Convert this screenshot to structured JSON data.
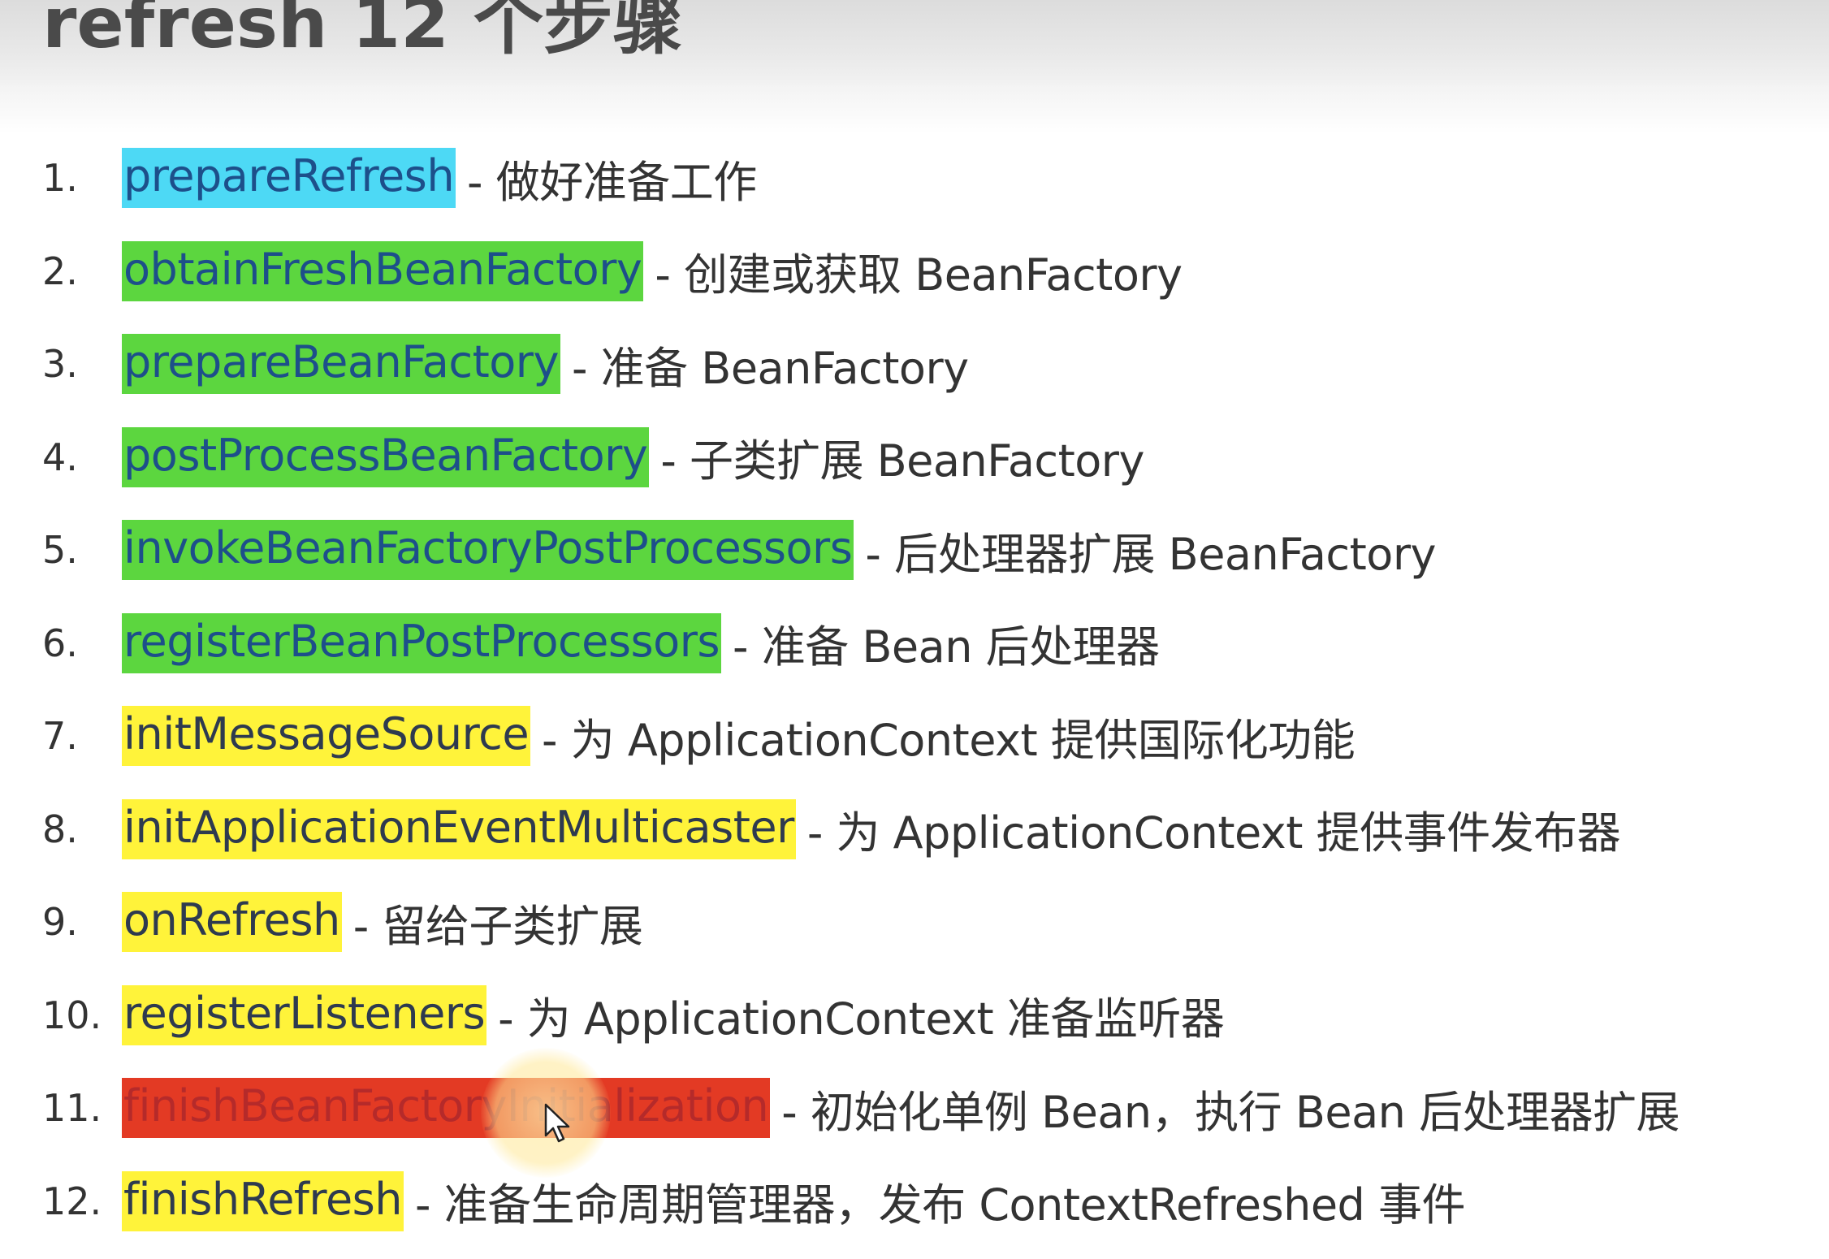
{
  "page": {
    "title": "refresh 12 个步骤"
  },
  "steps": [
    {
      "number": "1.",
      "method": "prepareRefresh",
      "highlight": "#4dd9f5",
      "description": "- 做好准备工作"
    },
    {
      "number": "2.",
      "method": "obtainFreshBeanFactory",
      "highlight": "#5cd63f",
      "description": "- 创建或获取 BeanFactory"
    },
    {
      "number": "3.",
      "method": "prepareBeanFactory",
      "highlight": "#5cd63f",
      "description": "- 准备 BeanFactory"
    },
    {
      "number": "4.",
      "method": "postProcessBeanFactory",
      "highlight": "#5cd63f",
      "description": "- 子类扩展 BeanFactory"
    },
    {
      "number": "5.",
      "method": "invokeBeanFactoryPostProcessors",
      "highlight": "#5cd63f",
      "description": "- 后处理器扩展 BeanFactory"
    },
    {
      "number": "6.",
      "method": "registerBeanPostProcessors",
      "highlight": "#5cd63f",
      "description": "- 准备 Bean 后处理器"
    },
    {
      "number": "7.",
      "method": "initMessageSource",
      "highlight": "#fff33a",
      "description": "- 为 ApplicationContext 提供国际化功能"
    },
    {
      "number": "8.",
      "method": "initApplicationEventMulticaster",
      "highlight": "#fff33a",
      "description": "- 为 ApplicationContext 提供事件发布器"
    },
    {
      "number": "9.",
      "method": "onRefresh",
      "highlight": "#fff33a",
      "description": "- 留给子类扩展"
    },
    {
      "number": "10.",
      "method": "registerListeners",
      "highlight": "#fff33a",
      "description": "- 为 ApplicationContext 准备监听器"
    },
    {
      "number": "11.",
      "method": "finishBeanFactoryInitialization",
      "highlight": "#e33a24",
      "description": "- 初始化单例 Bean，执行 Bean 后处理器扩展"
    },
    {
      "number": "12.",
      "method": "finishRefresh",
      "highlight": "#fff33a",
      "description": "- 准备生命周期管理器，发布 ContextRefreshed 事件"
    }
  ],
  "cursor": {
    "icon": "mouse-pointer-icon",
    "highlight_color": "#ffe89a"
  }
}
